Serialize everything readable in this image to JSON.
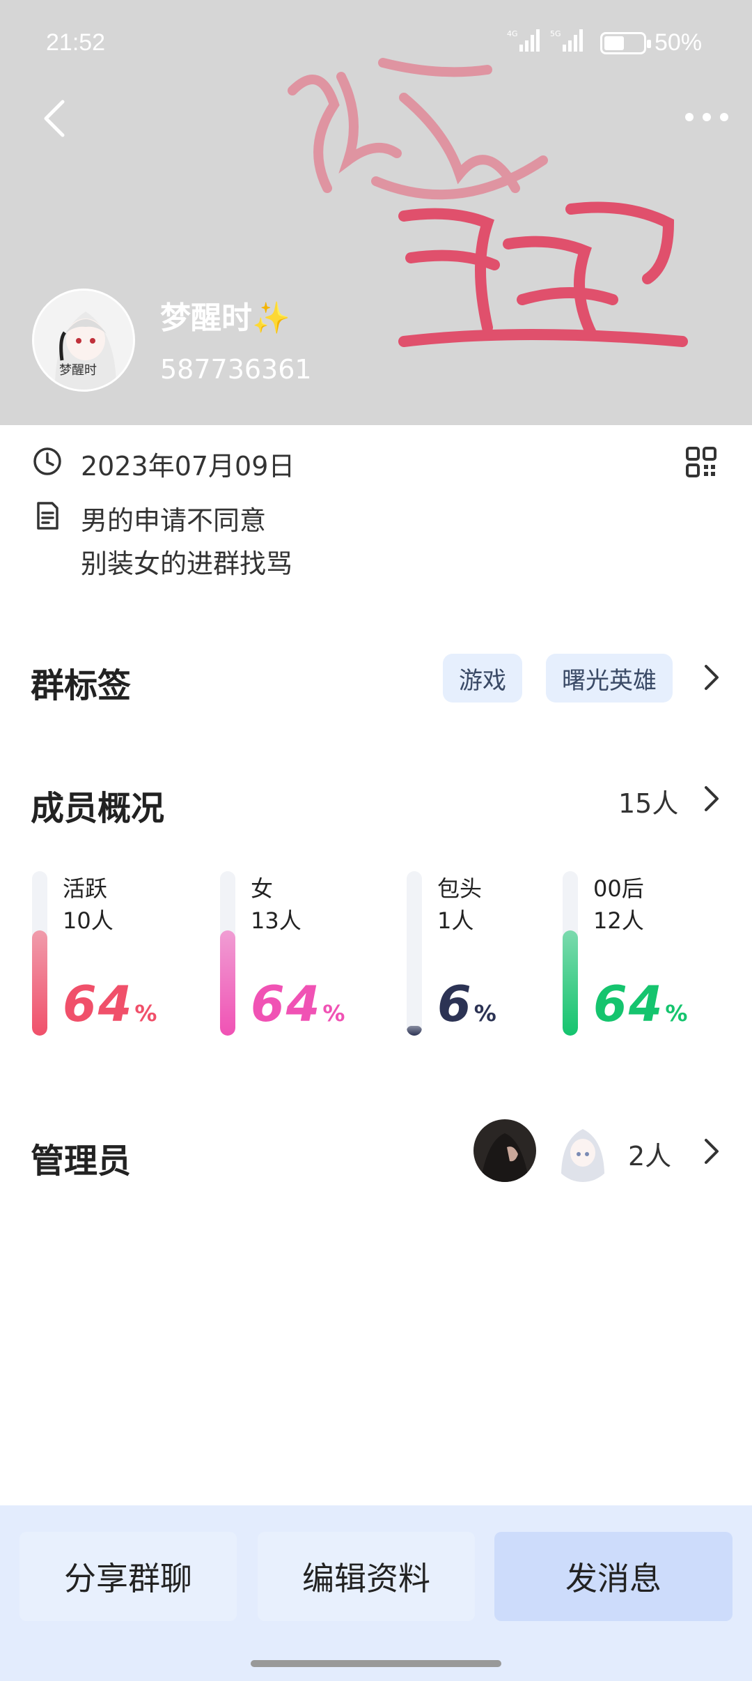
{
  "status_bar": {
    "time": "21:52",
    "network_1": "4G",
    "network_2": "5G",
    "battery": "50%"
  },
  "header": {
    "background_text": "纯爱 梦醒"
  },
  "profile": {
    "name": "梦醒时✨",
    "id": "587736361",
    "avatar_text": "梦醒时"
  },
  "info": {
    "date": "2023年07月09日",
    "description_line1": "男的申请不同意",
    "description_line2": "别装女的进群找骂"
  },
  "tags_section": {
    "title": "群标签",
    "tags": [
      "游戏",
      "曙光英雄"
    ]
  },
  "members": {
    "title": "成员概况",
    "count": "15人",
    "stats": [
      {
        "label": "活跃",
        "count": "10人",
        "percent": "64",
        "value": 64,
        "color": "#f0506a"
      },
      {
        "label": "女",
        "count": "13人",
        "percent": "64",
        "value": 64,
        "color": "#f052b4"
      },
      {
        "label": "包头",
        "count": "1人",
        "percent": "6",
        "value": 6,
        "color": "#2c3354"
      },
      {
        "label": "00后",
        "count": "12人",
        "percent": "64",
        "value": 64,
        "color": "#15c46e"
      }
    ],
    "percent_sign": "%"
  },
  "admins": {
    "title": "管理员",
    "count": "2人"
  },
  "bottom": {
    "share": "分享群聊",
    "edit": "编辑资料",
    "message": "发消息"
  }
}
